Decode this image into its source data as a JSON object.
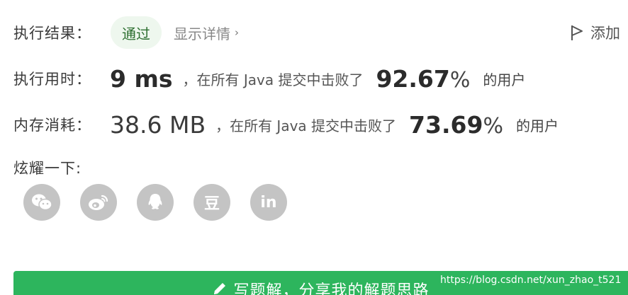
{
  "result": {
    "label": "执行结果：",
    "status": "通过",
    "details_link": "显示详情",
    "details_chevron": "›",
    "add_note": "添加"
  },
  "runtime": {
    "label": "执行用时：",
    "value": "9 ms",
    "beat_text": "，在所有 Java 提交中击败了",
    "percent": "92.67",
    "percent_sign": "%",
    "suffix": "的用户"
  },
  "memory": {
    "label": "内存消耗：",
    "value": "38.6 MB",
    "beat_text": "，在所有 Java 提交中击败了",
    "percent": "73.69",
    "percent_sign": "%",
    "suffix": "的用户"
  },
  "share": {
    "label": "炫耀一下:",
    "icons": [
      "wechat-icon",
      "weibo-icon",
      "qq-icon",
      "douban-icon",
      "linkedin-icon"
    ],
    "douban_text": "豆",
    "linkedin_text": "in"
  },
  "solution_button": {
    "label": "写题解，分享我的解题思路"
  },
  "watermark": "https://blog.csdn.net/xun_zhao_t521",
  "colors": {
    "accent_green": "#2db55d",
    "pill_bg": "#eef7ee",
    "icon_gray": "#c4c4c4"
  }
}
